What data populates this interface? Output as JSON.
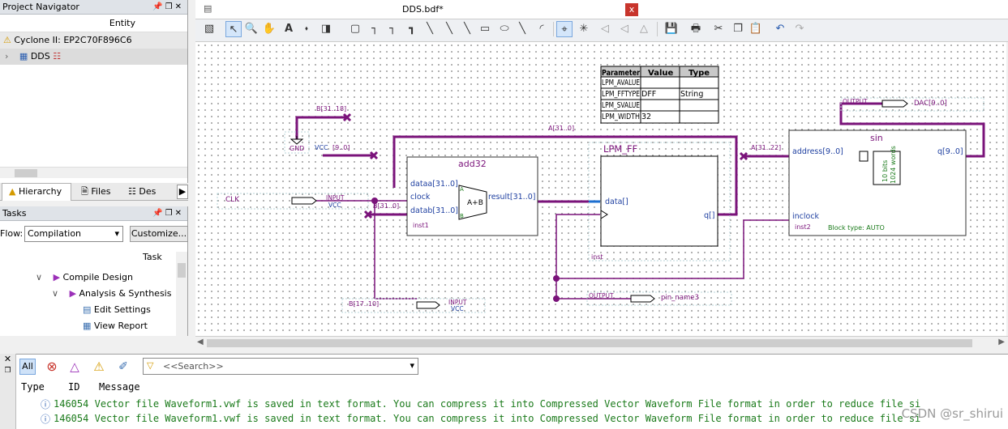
{
  "project_navigator": {
    "title": "Project Navigator",
    "column": "Entity",
    "device": "Cyclone II: EP2C70F896C6",
    "top_entity": "DDS"
  },
  "nav_tabs": [
    "Hierarchy",
    "Files",
    "Des"
  ],
  "tasks": {
    "title": "Tasks",
    "flow_label": "Flow:",
    "flow_value": "Compilation",
    "customize": "Customize...",
    "column": "Task",
    "items": [
      "Compile Design",
      "Analysis & Synthesis",
      "Edit Settings",
      "View Report"
    ]
  },
  "document": {
    "title": "DDS.bdf*",
    "close": "x"
  },
  "schematic": {
    "add32": {
      "name": "add32",
      "ports_in": [
        "dataa[31..0]",
        "clock",
        "datab[31..0]"
      ],
      "port_out": "result[31..0]",
      "op": "A+B",
      "inst": "inst1",
      "a": "A",
      "b": "B"
    },
    "lpm_ff": {
      "name": "LPM_FF",
      "port_in": "data[]",
      "port_out": "q[]",
      "inst": "inst"
    },
    "sin": {
      "name": "sin",
      "port_addr": "address[9..0]",
      "port_clk": "inclock",
      "port_out": "q[9..0]",
      "inst": "inst2",
      "block_type": "Block type: AUTO",
      "bits": "10 bits",
      "words": "1024 words"
    },
    "param_table": {
      "headers": [
        "Parameter",
        "Value",
        "Type"
      ],
      "rows": [
        [
          "LPM_AVALUE",
          "",
          ""
        ],
        [
          "LPM_FFTYPE",
          "DFF",
          "String"
        ],
        [
          "LPM_SVALUE",
          "",
          ""
        ],
        [
          "LPM_WIDTH",
          "32",
          ""
        ]
      ]
    },
    "labels": {
      "b31_18": "B[31..18]",
      "gnd": "GND",
      "vcc_label": "VCC",
      "b9_0": "[9..0]",
      "a31_0": "A[31..0]",
      "a31_22": "A[31..22]",
      "b31_0": "B[31..0]",
      "b17_10": "B[17..10]",
      "clk": "CLK",
      "input": "INPUT",
      "vcc": "VCC",
      "output": "OUTPUT",
      "dac": "DAC[9..0]",
      "pin_name3": "pin_name3"
    }
  },
  "messages": {
    "filters": [
      "All"
    ],
    "search_placeholder": "<<Search>>",
    "headers": [
      "Type",
      "ID",
      "Message"
    ],
    "rows": [
      {
        "id": "146054",
        "text": "Vector file Waveform1.vwf is saved in text format. You can compress it into Compressed Vector Waveform File format in order to reduce file si"
      },
      {
        "id": "146054",
        "text": "Vector file Waveform1.vwf is saved in text format. You can compress it into Compressed Vector Waveform File format in order to reduce file si"
      }
    ]
  },
  "watermark": "CSDN @sr_shirui",
  "colors": {
    "bus": "#7a137a",
    "wire_blue": "#1e6fd0",
    "msg_green": "#1a7a1a",
    "block_border": "#333333"
  }
}
